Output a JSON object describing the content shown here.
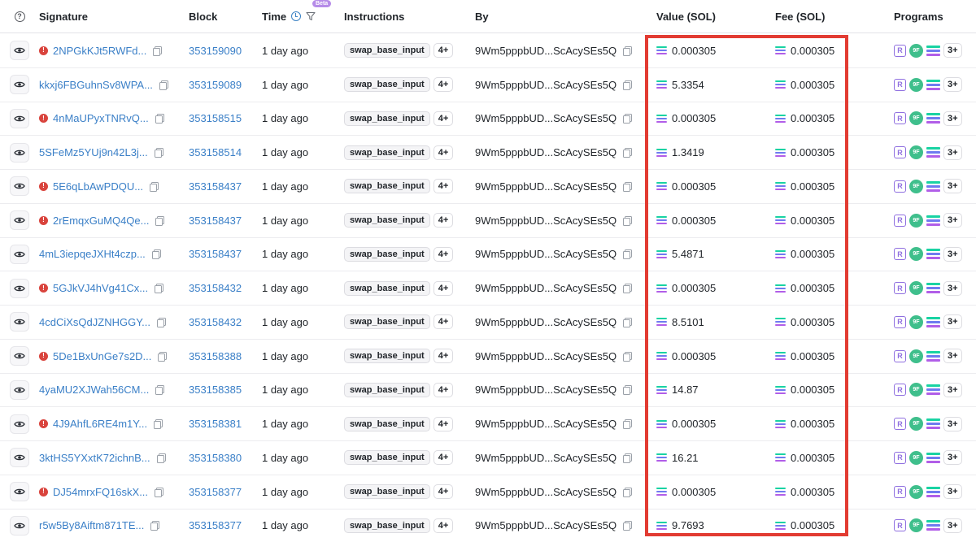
{
  "header": {
    "help_icon": "question-circle-icon",
    "signature": "Signature",
    "block": "Block",
    "time": "Time",
    "beta": "Beta",
    "instructions": "Instructions",
    "by": "By",
    "value": "Value (SOL)",
    "fee": "Fee (SOL)",
    "programs": "Programs"
  },
  "rows": [
    {
      "error": true,
      "signature": "2NPGkKJt5RWFd...",
      "block": "353159090",
      "time": "1 day ago",
      "instruction": "swap_base_input",
      "more": "4+",
      "by": "9Wm5pppbUD...ScAcySEs5Q",
      "value": "0.000305",
      "fee": "0.000305",
      "programs_more": "3+"
    },
    {
      "error": false,
      "signature": "kkxj6FBGuhnSv8WPA...",
      "block": "353159089",
      "time": "1 day ago",
      "instruction": "swap_base_input",
      "more": "4+",
      "by": "9Wm5pppbUD...ScAcySEs5Q",
      "value": "5.3354",
      "fee": "0.000305",
      "programs_more": "3+"
    },
    {
      "error": true,
      "signature": "4nMaUPyxTNRvQ...",
      "block": "353158515",
      "time": "1 day ago",
      "instruction": "swap_base_input",
      "more": "4+",
      "by": "9Wm5pppbUD...ScAcySEs5Q",
      "value": "0.000305",
      "fee": "0.000305",
      "programs_more": "3+"
    },
    {
      "error": false,
      "signature": "5SFeMz5YUj9n42L3j...",
      "block": "353158514",
      "time": "1 day ago",
      "instruction": "swap_base_input",
      "more": "4+",
      "by": "9Wm5pppbUD...ScAcySEs5Q",
      "value": "1.3419",
      "fee": "0.000305",
      "programs_more": "3+"
    },
    {
      "error": true,
      "signature": "5E6qLbAwPDQU...",
      "block": "353158437",
      "time": "1 day ago",
      "instruction": "swap_base_input",
      "more": "4+",
      "by": "9Wm5pppbUD...ScAcySEs5Q",
      "value": "0.000305",
      "fee": "0.000305",
      "programs_more": "3+"
    },
    {
      "error": true,
      "signature": "2rEmqxGuMQ4Qe...",
      "block": "353158437",
      "time": "1 day ago",
      "instruction": "swap_base_input",
      "more": "4+",
      "by": "9Wm5pppbUD...ScAcySEs5Q",
      "value": "0.000305",
      "fee": "0.000305",
      "programs_more": "3+"
    },
    {
      "error": false,
      "signature": "4mL3iepqeJXHt4czp...",
      "block": "353158437",
      "time": "1 day ago",
      "instruction": "swap_base_input",
      "more": "4+",
      "by": "9Wm5pppbUD...ScAcySEs5Q",
      "value": "5.4871",
      "fee": "0.000305",
      "programs_more": "3+"
    },
    {
      "error": true,
      "signature": "5GJkVJ4hVg41Cx...",
      "block": "353158432",
      "time": "1 day ago",
      "instruction": "swap_base_input",
      "more": "4+",
      "by": "9Wm5pppbUD...ScAcySEs5Q",
      "value": "0.000305",
      "fee": "0.000305",
      "programs_more": "3+"
    },
    {
      "error": false,
      "signature": "4cdCiXsQdJZNHGGY...",
      "block": "353158432",
      "time": "1 day ago",
      "instruction": "swap_base_input",
      "more": "4+",
      "by": "9Wm5pppbUD...ScAcySEs5Q",
      "value": "8.5101",
      "fee": "0.000305",
      "programs_more": "3+"
    },
    {
      "error": true,
      "signature": "5De1BxUnGe7s2D...",
      "block": "353158388",
      "time": "1 day ago",
      "instruction": "swap_base_input",
      "more": "4+",
      "by": "9Wm5pppbUD...ScAcySEs5Q",
      "value": "0.000305",
      "fee": "0.000305",
      "programs_more": "3+"
    },
    {
      "error": false,
      "signature": "4yaMU2XJWah56CM...",
      "block": "353158385",
      "time": "1 day ago",
      "instruction": "swap_base_input",
      "more": "4+",
      "by": "9Wm5pppbUD...ScAcySEs5Q",
      "value": "14.87",
      "fee": "0.000305",
      "programs_more": "3+"
    },
    {
      "error": true,
      "signature": "4J9AhfL6RE4m1Y...",
      "block": "353158381",
      "time": "1 day ago",
      "instruction": "swap_base_input",
      "more": "4+",
      "by": "9Wm5pppbUD...ScAcySEs5Q",
      "value": "0.000305",
      "fee": "0.000305",
      "programs_more": "3+"
    },
    {
      "error": false,
      "signature": "3ktHS5YXxtK72ichnB...",
      "block": "353158380",
      "time": "1 day ago",
      "instruction": "swap_base_input",
      "more": "4+",
      "by": "9Wm5pppbUD...ScAcySEs5Q",
      "value": "16.21",
      "fee": "0.000305",
      "programs_more": "3+"
    },
    {
      "error": true,
      "signature": "DJ54mrxFQ16skX...",
      "block": "353158377",
      "time": "1 day ago",
      "instruction": "swap_base_input",
      "more": "4+",
      "by": "9Wm5pppbUD...ScAcySEs5Q",
      "value": "0.000305",
      "fee": "0.000305",
      "programs_more": "3+"
    },
    {
      "error": false,
      "signature": "r5w5By8Aiftm871TE...",
      "block": "353158377",
      "time": "1 day ago",
      "instruction": "swap_base_input",
      "more": "4+",
      "by": "9Wm5pppbUD...ScAcySEs5Q",
      "value": "9.7693",
      "fee": "0.000305",
      "programs_more": "3+"
    }
  ],
  "program_icons": [
    "raydium-icon",
    "9f-icon",
    "solana-icon"
  ],
  "program_9f_label": "9F",
  "program_r_label": "R",
  "colors": {
    "link": "#3a7fc7",
    "error": "#d9443d",
    "highlight": "#e23b32",
    "beta": "#b68ce8"
  }
}
